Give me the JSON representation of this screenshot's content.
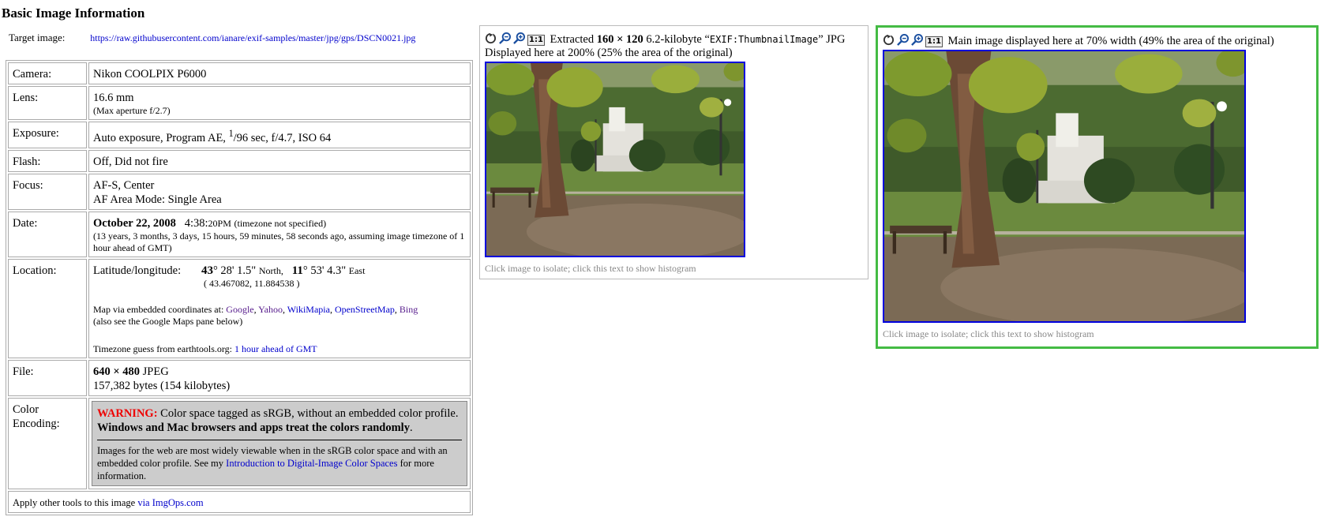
{
  "page": {
    "title": "Basic Image Information",
    "target_label": "Target image:",
    "target_url": "https://raw.githubusercontent.com/ianare/exif-samples/master/jpg/gps/DSCN0021.jpg"
  },
  "info": {
    "camera": {
      "label": "Camera:",
      "value": "Nikon COOLPIX P6000"
    },
    "lens": {
      "label": "Lens:",
      "value": "16.6 mm",
      "note": "(Max aperture f/2.7)"
    },
    "exposure": {
      "label": "Exposure:",
      "pre": "Auto exposure, Program AE,",
      "num": "1",
      "post": "/96 sec, f/4.7, ISO 64"
    },
    "flash": {
      "label": "Flash:",
      "value": "Off, Did not fire"
    },
    "focus": {
      "label": "Focus:",
      "line1": "AF-S, Center",
      "line2": "AF Area Mode: Single Area"
    },
    "date": {
      "label": "Date:",
      "day": "October 22, 2008",
      "time": "4:38:",
      "time_small": "20PM",
      "tz": "(timezone not specified)",
      "ago": "(13 years, 3 months, 3 days, 15 hours, 59 minutes, 58 seconds ago, assuming image timezone of 1 hour ahead of GMT)"
    },
    "location": {
      "label": "Location:",
      "latlon_label": "Latitude/longitude:",
      "lat_deg": "43",
      "lat_rest": "° 28' 1.5\"",
      "lat_dir": "North,",
      "lon_deg": "11",
      "lon_rest": "° 53' 4.3\"",
      "lon_dir": "East",
      "decimal": "( 43.467082, 11.884538 )",
      "map_intro": "Map via embedded coordinates at:",
      "map_links": [
        "Google",
        "Yahoo",
        "WikiMapia",
        "OpenStreetMap",
        "Bing"
      ],
      "map_note": "(also see the Google Maps pane below)",
      "tz_label": "Timezone guess from earthtools.org:",
      "tz_link": "1 hour ahead of GMT"
    },
    "file": {
      "label": "File:",
      "dims": "640 × 480",
      "type": "JPEG",
      "bytes": "157,382 bytes (154 kilobytes)"
    },
    "color": {
      "label": "Color Encoding:",
      "warn_title": "WARNING:",
      "warn_text": "Color space tagged as sRGB, without an embedded color profile.",
      "warn_bold": "Windows and Mac browsers and apps treat the colors randomly",
      "warn_period": ".",
      "note_pre": "Images for the web are most widely viewable when in the sRGB color space and with an embedded color profile. See my",
      "note_link": "Introduction to Digital-Image Color Spaces",
      "note_post": "for more information."
    },
    "footer": {
      "pre": "Apply other tools to this image",
      "link": "via ImgOps.com"
    }
  },
  "thumb_panel": {
    "extracted": "Extracted",
    "dims": "160 × 120",
    "size": "6.2-kilobyte",
    "tag": "EXIF:ThumbnailImage",
    "type": "JPG",
    "display": "Displayed here at 200% (25% the area of the original)",
    "caption": "Click image to isolate; click this text to show histogram",
    "one_to_one": "1:1"
  },
  "main_panel": {
    "display": "Main image displayed here at 70% width (49% the area of the original)",
    "caption": "Click image to isolate; click this text to show histogram",
    "one_to_one": "1:1"
  },
  "icons": [
    "rotate-icon",
    "zoom-out-icon",
    "zoom-in-icon",
    "actual-size-icon"
  ],
  "colors": {
    "warning": "#ee0000",
    "link": "#0000cc",
    "visited": "#551a8b",
    "frame": "#0000dd",
    "main_border": "#44bb44"
  }
}
